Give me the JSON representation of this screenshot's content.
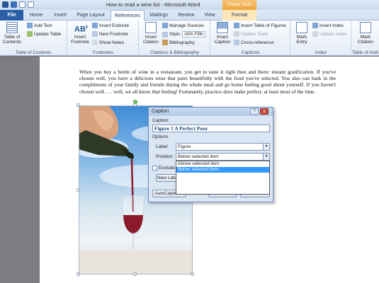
{
  "window": {
    "title": "How to read a wine list - Microsoft Word",
    "context_tab_group": "Picture Tools"
  },
  "tabs": [
    {
      "label": "File"
    },
    {
      "label": "Home"
    },
    {
      "label": "Insert"
    },
    {
      "label": "Page Layout"
    },
    {
      "label": "References"
    },
    {
      "label": "Mailings"
    },
    {
      "label": "Review"
    },
    {
      "label": "View"
    },
    {
      "label": "Format"
    }
  ],
  "ribbon": {
    "toc": {
      "table_of_contents": "Table of Contents",
      "add_text": "Add Text",
      "update_table": "Update Table",
      "group": "Table of Contents"
    },
    "footnotes": {
      "insert_footnote": "Insert Footnote",
      "insert_endnote": "Insert Endnote",
      "next_footnote": "Next Footnote",
      "show_notes": "Show Notes",
      "group": "Footnotes"
    },
    "citations": {
      "insert_citation": "Insert Citation",
      "manage_sources": "Manage Sources",
      "style_label": "Style:",
      "style_value": "APA Fifth",
      "bibliography": "Bibliography",
      "group": "Citations & Bibliography"
    },
    "captions": {
      "insert_caption": "Insert Caption",
      "insert_table_of_figures": "Insert Table of Figures",
      "update_table": "Update Table",
      "cross_reference": "Cross-reference",
      "group": "Captions"
    },
    "index": {
      "mark_entry": "Mark Entry",
      "insert_index": "Insert Index",
      "update_index": "Update Index",
      "group": "Index"
    },
    "toa": {
      "mark_citation": "Mark Citation",
      "group": "Table of Autho"
    }
  },
  "document": {
    "paragraph_parts": [
      "When you buy a bottle of wine in a restaurant, you get to taste it right then and there: instant gratification. If you've chosen well, you have a delicious wine that pairs beautifully with the food you've selected. You also can bask in the compliments of your family and friends during the whole meal and go home feeling good about yourself. If you haven't chosen well . . . well, we all know ",
      "that",
      " feeling! Fortunately, practice ",
      "does",
      " make perfect, at least most of the time."
    ]
  },
  "dialog": {
    "title": "Caption",
    "help": "?",
    "close": "x",
    "caption_label": "Caption:",
    "caption_value": "Figure 1 A Perfect Pour",
    "options_label": "Options",
    "label_label": "Label:",
    "label_value": "Figure",
    "position_label": "Position:",
    "position_value": "Below selected item",
    "position_options": [
      "Above selected item",
      "Below selected item"
    ],
    "exclude_label": "Exclude",
    "new_label_button": "New Label...",
    "autocaption_button": "AutoCaption...",
    "ok_button": "OK",
    "cancel_button": "Cancel"
  }
}
